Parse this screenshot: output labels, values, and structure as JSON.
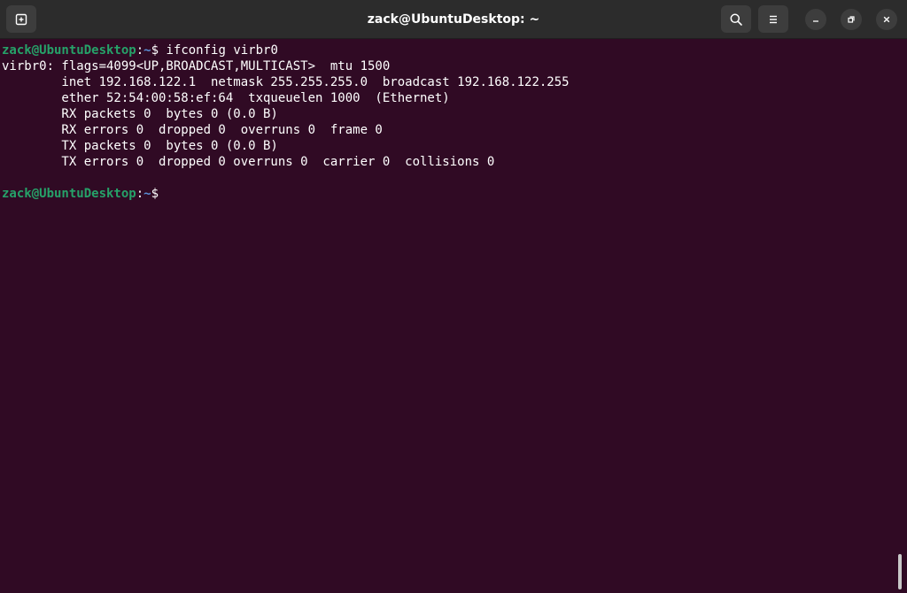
{
  "window": {
    "title": "zack@UbuntuDesktop: ~"
  },
  "icons": {
    "new_tab": "new-tab-icon",
    "search": "search-icon",
    "menu": "hamburger-menu-icon",
    "minimize": "minimize-icon",
    "maximize": "restore-icon",
    "close": "close-icon"
  },
  "colors": {
    "background": "#300a24",
    "prompt_user": "#26a269",
    "prompt_path": "#5a8fd6",
    "titlebar": "#2c2c2c"
  },
  "terminal": {
    "prompt1": {
      "user_host": "zack@UbuntuDesktop",
      "separator": ":",
      "path": "~",
      "symbol": "$",
      "command": " ifconfig virbr0"
    },
    "output": [
      "virbr0: flags=4099<UP,BROADCAST,MULTICAST>  mtu 1500",
      "        inet 192.168.122.1  netmask 255.255.255.0  broadcast 192.168.122.255",
      "        ether 52:54:00:58:ef:64  txqueuelen 1000  (Ethernet)",
      "        RX packets 0  bytes 0 (0.0 B)",
      "        RX errors 0  dropped 0  overruns 0  frame 0",
      "        TX packets 0  bytes 0 (0.0 B)",
      "        TX errors 0  dropped 0 overruns 0  carrier 0  collisions 0",
      ""
    ],
    "prompt2": {
      "user_host": "zack@UbuntuDesktop",
      "separator": ":",
      "path": "~",
      "symbol": "$",
      "command": ""
    }
  }
}
